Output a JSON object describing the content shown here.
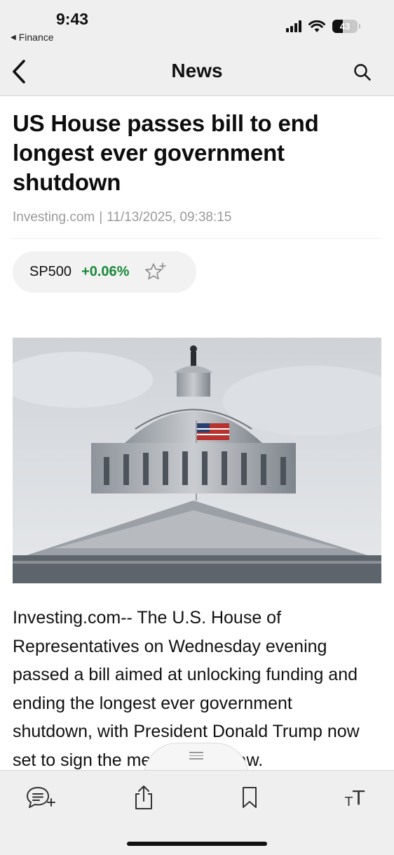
{
  "status_bar": {
    "time": "9:43",
    "back_app": "Finance",
    "battery": "43"
  },
  "nav": {
    "title": "News"
  },
  "article": {
    "headline": "US House passes bill to end longest ever government shutdown",
    "source": "Investing.com",
    "separator": "|",
    "timestamp": "11/13/2025, 09:38:15",
    "ticker": {
      "symbol": "SP500",
      "change": "+0.06%",
      "change_color": "#1a8a3a"
    },
    "body": "Investing.com-- The U.S. House of Representatives on Wednesday evening passed a bill aimed at unlocking funding and ending the longest ever government shutdown, with President Donald Trump now set to sign the measure into law."
  },
  "toolbar": {
    "items": [
      "comment-icon",
      "share-icon",
      "bookmark-icon",
      "text-size-icon"
    ],
    "text_size_small": "T",
    "text_size_big": "T"
  }
}
